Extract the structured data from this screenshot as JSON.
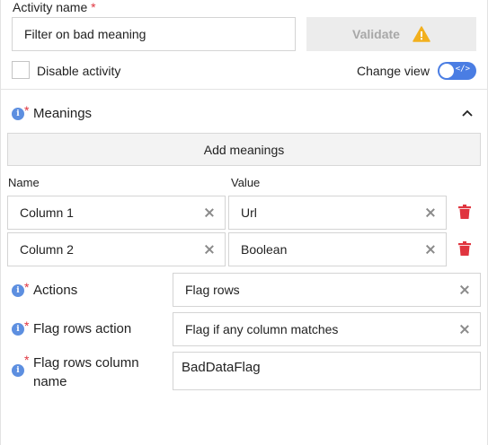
{
  "activity": {
    "label": "Activity name",
    "required_mark": "*",
    "value": "Filter on bad meaning",
    "validate_label": "Validate",
    "disable_label": "Disable activity",
    "change_view_label": "Change view",
    "toggle_code": "</>"
  },
  "meanings": {
    "title": "Meanings",
    "add_label": "Add meanings",
    "name_header": "Name",
    "value_header": "Value",
    "rows": [
      {
        "name": "Column 1",
        "value": "Url"
      },
      {
        "name": "Column 2",
        "value": "Boolean"
      }
    ]
  },
  "actions": {
    "label": "Actions",
    "value": "Flag rows"
  },
  "flag_rows_action": {
    "label": "Flag rows action",
    "value": "Flag if any column matches"
  },
  "flag_rows_column": {
    "label_line1": "Flag rows column",
    "label_line2": "name",
    "value": "BadDataFlag"
  },
  "colors": {
    "accent": "#4a7de3",
    "required": "#e0353f",
    "warning": "#f2b01e",
    "delete": "#e0353f"
  },
  "icons": {
    "warning": "warning-triangle-icon",
    "info": "info-icon",
    "collapse": "chevron-up-icon",
    "clear": "close-icon",
    "delete": "trash-icon"
  }
}
